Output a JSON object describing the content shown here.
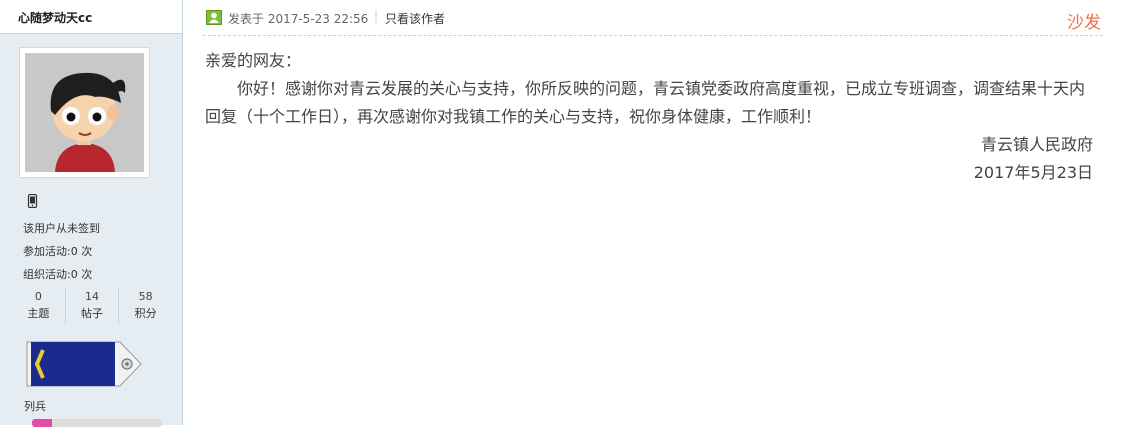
{
  "sidebar": {
    "username": "心随梦动天cc",
    "sign_status": "该用户从未签到",
    "activity_joined": "参加活动:0 次",
    "activity_organized": "组织活动:0 次",
    "counts": [
      {
        "value": "0",
        "label": "主题"
      },
      {
        "value": "14",
        "label": "帖子"
      },
      {
        "value": "58",
        "label": "积分"
      }
    ],
    "rank": "列兵",
    "rank_progress_percent": 15,
    "icons": {
      "mobile": "mobile-phone-icon",
      "rank_badge": "rank-badge-icon"
    }
  },
  "post": {
    "posted_at": "发表于 2017-5-23 22:56",
    "separator": "|",
    "only_author": "只看该作者",
    "floor": "沙发",
    "greeting": "亲爱的网友：",
    "body": "你好！感谢你对青云发展的关心与支持，你所反映的问题，青云镇党委政府高度重视，已成立专班调查，调查结果十天内回复（十个工作日），再次感谢你对我镇工作的关心与支持，祝你身体健康，工作顺利！",
    "signature_org": "青云镇人民政府",
    "signature_date": "2017年5月23日"
  },
  "colors": {
    "floor_label": "#f26c4f",
    "sidebar_bg": "#e5edf2",
    "progress": "#e04ca8"
  }
}
